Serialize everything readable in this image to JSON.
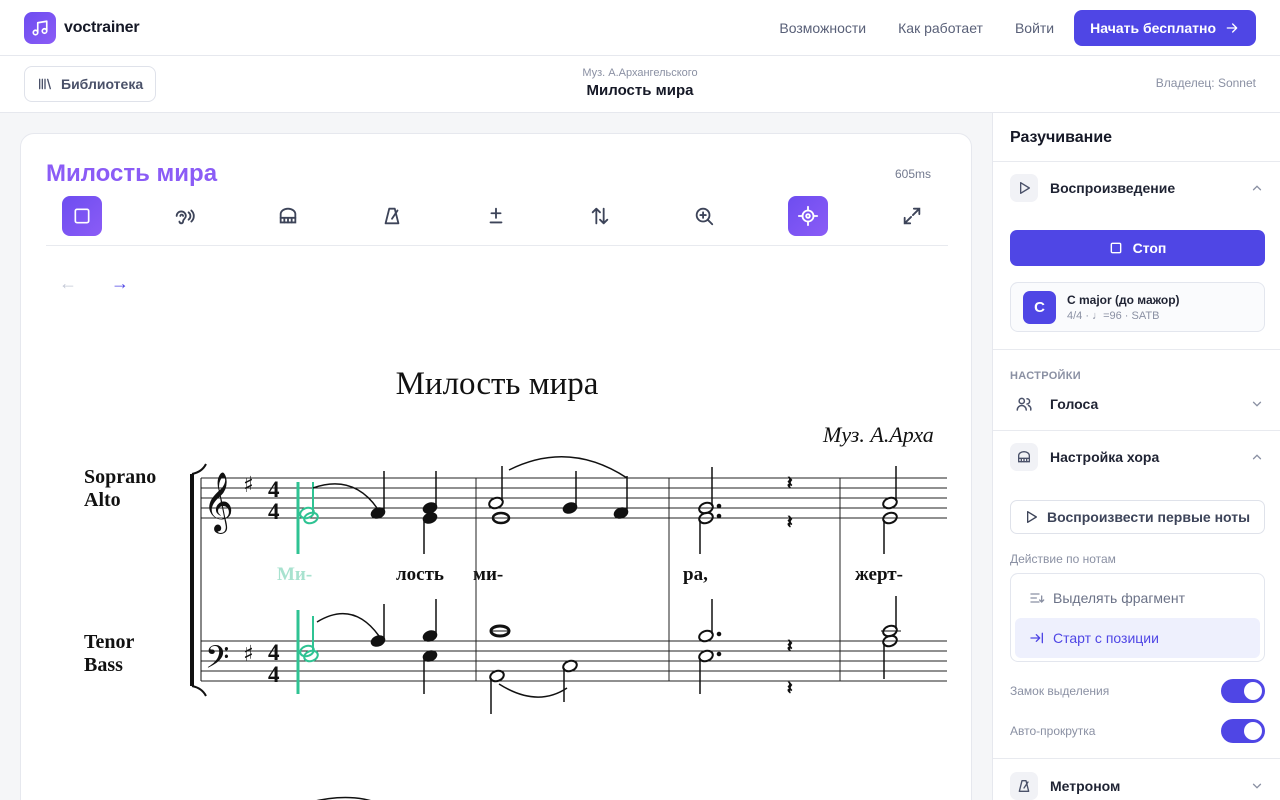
{
  "app": {
    "name": "voctrainer",
    "logo_icon": "music-note-icon",
    "accent": "#4f46e5",
    "accent2": "#8b5cf6"
  },
  "nav": {
    "links": [
      "Возможности",
      "Как работает",
      "Войти"
    ],
    "cta": "Начать бесплатно"
  },
  "subheader": {
    "library_label": "Библиотека",
    "composer": "Муз. А.Архангельского",
    "title": "Милость мира",
    "owner": "Владелец: Sonnet"
  },
  "card": {
    "title": "Милость мира",
    "latency": "605ms",
    "tools": [
      {
        "name": "stop-square-icon",
        "active": true
      },
      {
        "name": "ear-sound-icon",
        "active": false
      },
      {
        "name": "piano-icon",
        "active": false
      },
      {
        "name": "metronome-icon",
        "active": false
      },
      {
        "name": "plus-minus-icon",
        "active": false
      },
      {
        "name": "transpose-arrows-icon",
        "active": false
      },
      {
        "name": "zoom-in-icon",
        "active": false
      },
      {
        "name": "follow-target-icon",
        "active": true
      },
      {
        "name": "fullscreen-icon",
        "active": false
      }
    ],
    "prev_arrow": "←",
    "next_arrow": "→"
  },
  "score": {
    "title": "Милость мира",
    "composer": "Муз. А.Арха",
    "upper_voices": [
      "Soprano",
      "Alto"
    ],
    "lower_voices": [
      "Tenor",
      "Bass"
    ],
    "lyrics": [
      "Ми-",
      "лость",
      "ми-",
      "ра,",
      "жерт-"
    ],
    "time_signature": [
      "4",
      "4"
    ],
    "highlight_color": "#2fc393"
  },
  "panel": {
    "heading": "Разучивание",
    "playback": {
      "label": "Воспроизведение",
      "stop_label": "Стоп"
    },
    "key": {
      "badge": "C",
      "name": "C major (до мажор)",
      "meta": "4/4 · ♩=96 · SATB"
    },
    "settings_caption": "НАСТРОЙКИ",
    "voices_label": "Голоса",
    "choir_label": "Настройка хора",
    "play_first_notes": "Воспроизвести первые ноты",
    "note_action_caption": "Действие по нотам",
    "note_actions": [
      "Выделять фрагмент",
      "Старт с позиции"
    ],
    "toggles": [
      {
        "label": "Замок выделения",
        "on": true
      },
      {
        "label": "Авто-прокрутка",
        "on": true
      }
    ],
    "metronome_label": "Метроном"
  }
}
